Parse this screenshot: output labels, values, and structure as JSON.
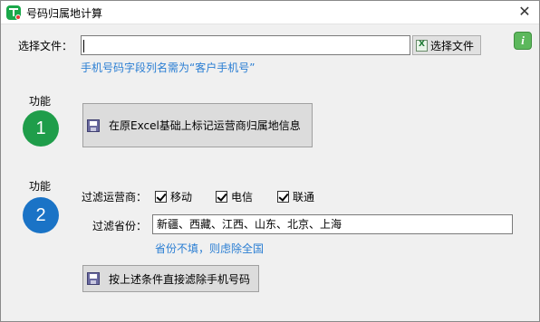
{
  "window": {
    "title": "号码归属地计算",
    "close": "✕"
  },
  "file": {
    "label": "选择文件：",
    "value": "",
    "choose_button": "选择文件",
    "hint": "手机号码字段列名需为“客户手机号”"
  },
  "feature1": {
    "caption": "功能",
    "number": "1",
    "button": "在原Excel基础上标记运营商归属地信息"
  },
  "feature2": {
    "caption": "功能",
    "number": "2",
    "carrier_label": "过滤运营商：",
    "carriers": [
      {
        "label": "移动",
        "checked": true
      },
      {
        "label": "电信",
        "checked": true
      },
      {
        "label": "联通",
        "checked": true
      }
    ],
    "province_label": "过滤省份：",
    "province_value": "新疆、西藏、江西、山东、北京、上海",
    "province_hint": "省份不填，则虑除全国",
    "button": "按上述条件直接滤除手机号码"
  },
  "info_icon": "i",
  "colors": {
    "green_badge": "#1f9d4a",
    "blue_badge": "#1a73c6",
    "hint_blue": "#2a7ed3"
  }
}
